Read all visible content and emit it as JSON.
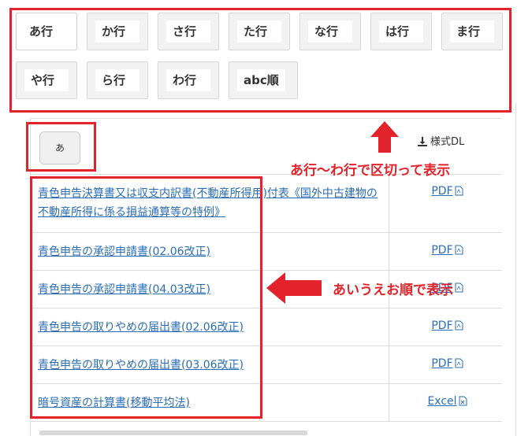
{
  "tabs": [
    {
      "label": "あ行"
    },
    {
      "label": "か行"
    },
    {
      "label": "さ行"
    },
    {
      "label": "た行"
    },
    {
      "label": "な行"
    },
    {
      "label": "は行"
    },
    {
      "label": "ま行"
    },
    {
      "label": "や行"
    },
    {
      "label": "ら行"
    },
    {
      "label": "わ行"
    },
    {
      "label": "abc順"
    }
  ],
  "subindex": {
    "label": "あ"
  },
  "download": {
    "label": "様式DL"
  },
  "rows": [
    {
      "name": "青色申告決算書又は収支内訳書(不動産所得用)付表《国外中古建物の不動産所得に係る損益通算等の特例》",
      "file": "PDF"
    },
    {
      "name": "青色申告の承認申請書(02.06改正)",
      "file": "PDF"
    },
    {
      "name": "青色申告の承認申請書(04.03改正)",
      "file": "PDF"
    },
    {
      "name": "青色申告の取りやめの届出書(02.06改正)",
      "file": "PDF"
    },
    {
      "name": "青色申告の取りやめの届出書(03.06改正)",
      "file": "PDF"
    },
    {
      "name": "暗号資産の計算書(移動平均法)",
      "file": "Excel"
    }
  ],
  "annotations": {
    "tabs_note": "あ行～わ行で区切って表示",
    "list_note": "あいうえお順で表示",
    "color": "#e3232b"
  }
}
